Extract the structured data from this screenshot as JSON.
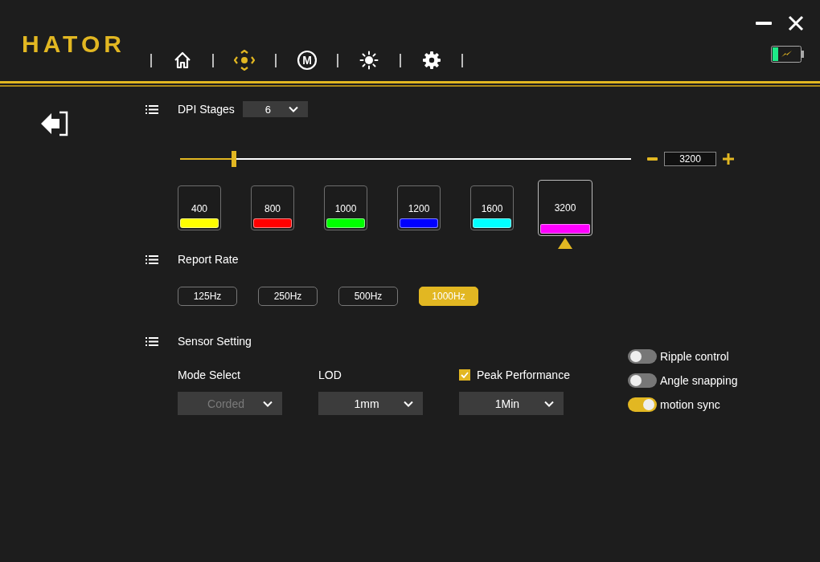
{
  "logo": "HATOR",
  "nav_tabs": [
    {
      "kind": "home",
      "selected": false
    },
    {
      "kind": "dpi",
      "selected": true
    },
    {
      "kind": "macro",
      "label": "M",
      "selected": false
    },
    {
      "kind": "lighting",
      "selected": false
    },
    {
      "kind": "settings",
      "selected": false
    }
  ],
  "dpi": {
    "title": "DPI Stages",
    "stages_count": "6",
    "slider": {
      "level": 0.12
    },
    "value": "3200",
    "stages": [
      {
        "value": "400",
        "color": "#ffff00",
        "selected": false
      },
      {
        "value": "800",
        "color": "#ff0000",
        "selected": false
      },
      {
        "value": "1000",
        "color": "#00ff00",
        "selected": false
      },
      {
        "value": "1200",
        "color": "#0000ff",
        "selected": false
      },
      {
        "value": "1600",
        "color": "#00ffff",
        "selected": false
      },
      {
        "value": "3200",
        "color": "#ff00ff",
        "selected": true
      }
    ]
  },
  "report_rate": {
    "title": "Report Rate",
    "options": [
      {
        "label": "125Hz",
        "selected": false
      },
      {
        "label": "250Hz",
        "selected": false
      },
      {
        "label": "500Hz",
        "selected": false
      },
      {
        "label": "1000Hz",
        "selected": true
      }
    ]
  },
  "sensor": {
    "title": "Sensor Setting",
    "selects": [
      {
        "kind": "label",
        "label": "Mode Select",
        "value": "Corded",
        "disabled": true
      },
      {
        "kind": "label",
        "label": "LOD",
        "value": "1mm",
        "disabled": false
      },
      {
        "kind": "checkbox",
        "label": "Peak Performance",
        "checked": true,
        "value": "1Min",
        "disabled": false
      }
    ],
    "toggles": [
      {
        "label": "Ripple control",
        "on": false
      },
      {
        "label": "Angle snapping",
        "on": false
      },
      {
        "label": "motion sync",
        "on": true
      }
    ]
  }
}
